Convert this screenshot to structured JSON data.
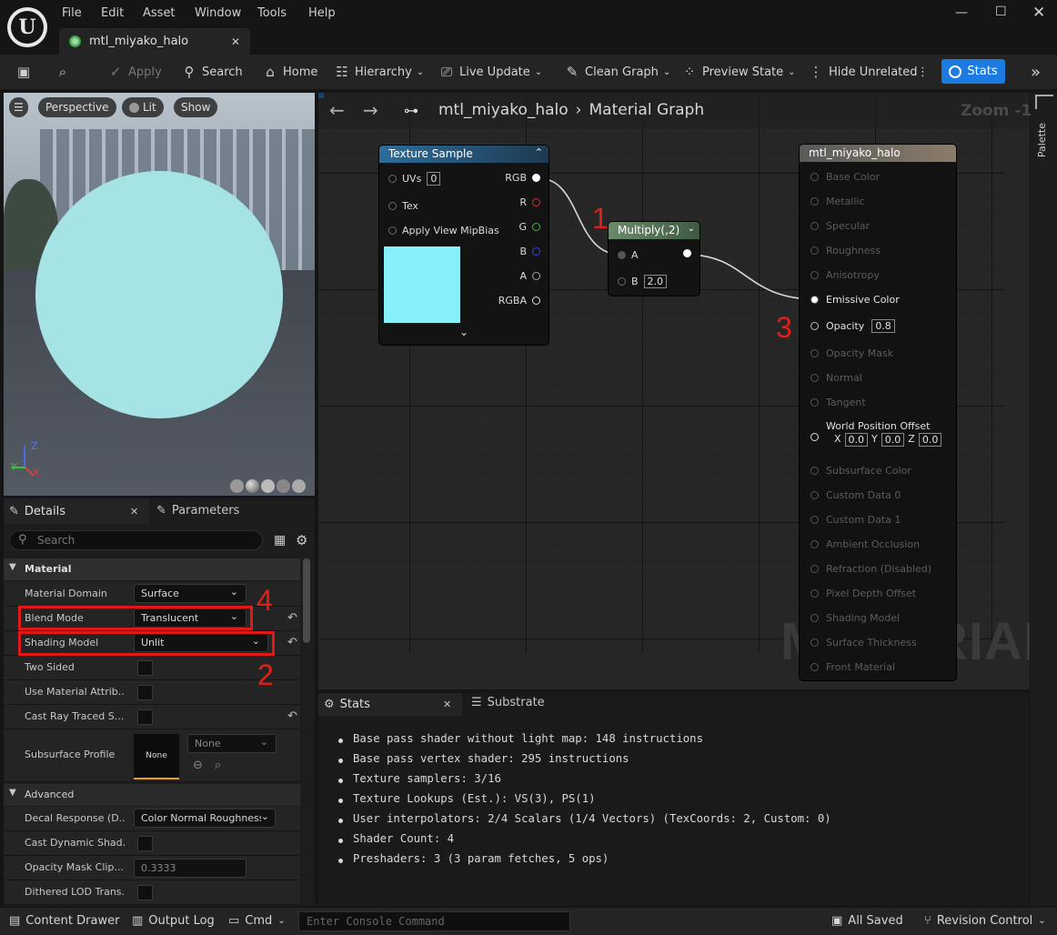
{
  "menu": [
    "File",
    "Edit",
    "Asset",
    "Window",
    "Tools",
    "Help"
  ],
  "tab": {
    "title": "mtl_miyako_halo"
  },
  "toolbar": {
    "apply": "Apply",
    "search": "Search",
    "home": "Home",
    "hierarchy": "Hierarchy",
    "live_update": "Live Update",
    "clean_graph": "Clean Graph",
    "preview_state": "Preview State",
    "hide_unrelated": "Hide Unrelated",
    "stats": "Stats"
  },
  "viewport": {
    "perspective": "Perspective",
    "lit": "Lit",
    "show": "Show",
    "axes": {
      "x": "X",
      "y": "Y",
      "z": "Z"
    }
  },
  "details": {
    "tab_details": "Details",
    "tab_parameters": "Parameters",
    "search_placeholder": "Search",
    "section_material": "Material",
    "section_advanced": "Advanced",
    "props": {
      "material_domain": {
        "label": "Material Domain",
        "value": "Surface"
      },
      "blend_mode": {
        "label": "Blend Mode",
        "value": "Translucent"
      },
      "shading_model": {
        "label": "Shading Model",
        "value": "Unlit"
      },
      "two_sided": {
        "label": "Two Sided"
      },
      "use_material_attrib": {
        "label": "Use Material Attrib..."
      },
      "cast_ray_traced": {
        "label": "Cast Ray Traced S..."
      },
      "subsurface_profile": {
        "label": "Subsurface Profile",
        "thumb": "None",
        "value": "None"
      },
      "decal_response": {
        "label": "Decal Response (D...",
        "value": "Color Normal Roughness"
      },
      "cast_dynamic_shadow": {
        "label": "Cast Dynamic Shad..."
      },
      "opacity_mask_clip": {
        "label": "Opacity Mask Clip...",
        "value": "0.3333"
      },
      "dithered_lod": {
        "label": "Dithered LOD Trans..."
      }
    }
  },
  "graph": {
    "breadcrumb_asset": "mtl_miyako_halo",
    "breadcrumb_graph": "Material Graph",
    "zoom": "Zoom -1",
    "watermark": "MATERIAL",
    "texture_node": {
      "title": "Texture Sample",
      "inputs": {
        "uvs": "UVs",
        "uvs_val": "0",
        "tex": "Tex",
        "mip": "Apply View MipBias"
      },
      "outputs": [
        "RGB",
        "R",
        "G",
        "B",
        "A",
        "RGBA"
      ],
      "preview_color": "#86f0fb"
    },
    "multiply_node": {
      "title": "Multiply(,2)",
      "a": "A",
      "b": "B",
      "b_val": "2.0"
    },
    "result_node": {
      "title": "mtl_miyako_halo",
      "pins": [
        "Base Color",
        "Metallic",
        "Specular",
        "Roughness",
        "Anisotropy"
      ],
      "emissive": "Emissive Color",
      "opacity": "Opacity",
      "opacity_val": "0.8",
      "pins2": [
        "Opacity Mask",
        "Normal",
        "Tangent"
      ],
      "wpo": "World Position Offset",
      "wpo_x": "X",
      "wpo_y": "Y",
      "wpo_z": "Z",
      "wpo_val": "0.0",
      "pins3": [
        "Subsurface Color",
        "Custom Data 0",
        "Custom Data 1",
        "Ambient Occlusion",
        "Refraction (Disabled)",
        "Pixel Depth Offset",
        "Shading Model",
        "Surface Thickness",
        "Front Material"
      ]
    },
    "annotations": [
      "1",
      "2",
      "3",
      "4"
    ]
  },
  "stats_panel": {
    "tab_stats": "Stats",
    "tab_substrate": "Substrate",
    "lines": [
      "Base pass shader without light map: 148 instructions",
      "Base pass vertex shader: 295 instructions",
      "Texture samplers: 3/16",
      "Texture Lookups (Est.): VS(3), PS(1)",
      "User interpolators: 2/4 Scalars (1/4 Vectors) (TexCoords: 2, Custom: 0)",
      "Shader Count: 4",
      "Preshaders: 3  (3 param fetches, 5 ops)"
    ]
  },
  "palette": "Palette",
  "bottom": {
    "content_drawer": "Content Drawer",
    "output_log": "Output Log",
    "cmd": "Cmd",
    "console_placeholder": "Enter Console Command",
    "all_saved": "All Saved",
    "revision_control": "Revision Control"
  }
}
